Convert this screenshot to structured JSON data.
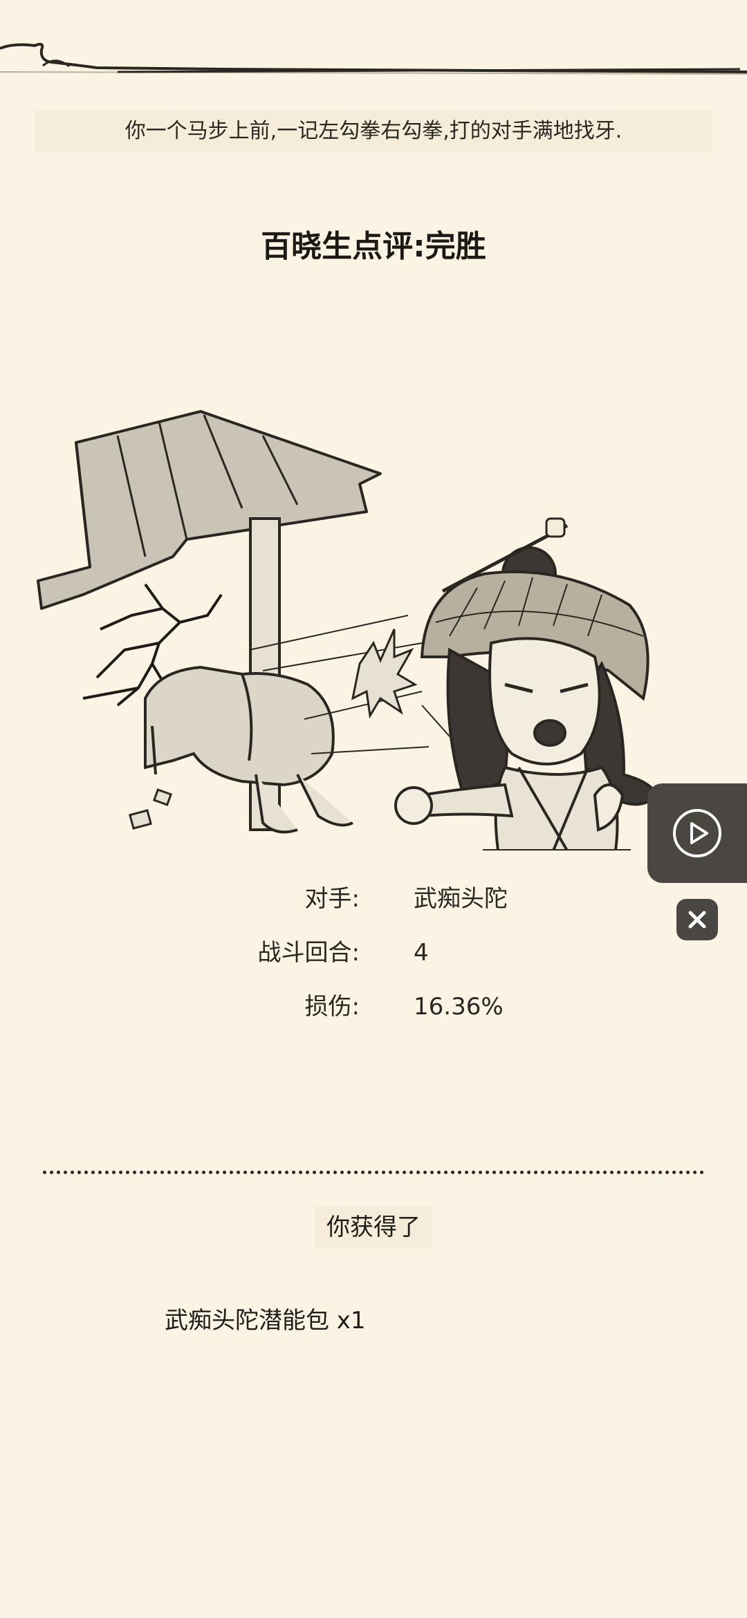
{
  "battle": {
    "narration": "你一个马步上前,一记左勾拳右勾拳,打的对手满地找牙.",
    "verdict": "百晓生点评:完胜"
  },
  "stats": [
    {
      "label": "对手:",
      "value": "武痴头陀"
    },
    {
      "label": "战斗回合:",
      "value": "4"
    },
    {
      "label": "损伤:",
      "value": "16.36%"
    }
  ],
  "reward": {
    "heading": "你获得了",
    "items": [
      "武痴头陀潜能包 x1"
    ]
  },
  "icons": {
    "video": "play-circle-icon",
    "close": "close-icon"
  },
  "colors": {
    "background": "#fbf4e4",
    "panel": "#f5edda",
    "floating_button": "#4a4642",
    "ink": "#2a2620"
  }
}
